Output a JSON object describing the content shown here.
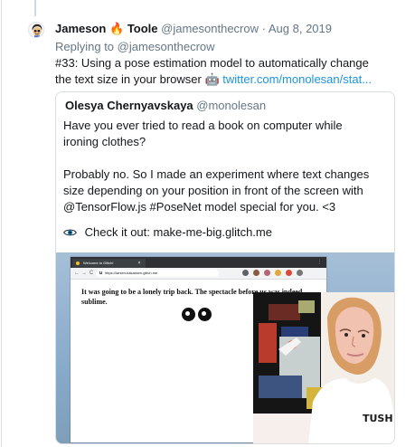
{
  "tweet": {
    "author_name_first": "Jameson",
    "author_emoji": "🔥",
    "author_name_last": "Toole",
    "handle": "@jamesonthecrow",
    "separator": "·",
    "date": "Aug 8, 2019",
    "replying_prefix": "Replying to",
    "replying_to": "@jamesonthecrow",
    "text": "#33: Using a pose estimation model to automatically change the text size in your browser",
    "link_emoji": "🤖",
    "link_text": "twitter.com/monolesan/stat..."
  },
  "quote": {
    "name": "Olesya Chernyavskaya",
    "handle": "@monolesan",
    "paragraphs": [
      "Have you ever tried to read a book on computer while ironing clothes?",
      "Probably no. So I made an experiment where text changes size depending on your position in front of the screen with @TensorFlow.js #PoseNet model special for you. <3"
    ],
    "check_emoji": "👁️",
    "check_text": "Check it out: make-me-big.glitch.me"
  },
  "browser": {
    "tab_title": "Welcome to Glitch!",
    "tab_close": "×",
    "nav_back": "←",
    "nav_forward": "→",
    "nav_reload": "C",
    "address": "https://larsen-kakassen.glitch.me",
    "menu_dots": "⋮",
    "page_text": "It was going to be a lonely trip back. The spectacle before us was indeed sublime."
  },
  "colors": {
    "link_blue": "#1b95e0",
    "text_primary": "#14171a",
    "text_secondary": "#657786",
    "quote_border": "#d8dee3",
    "browser_dark": "#2f3033",
    "sky_blue": "#9fb9d3"
  },
  "icons": {
    "avatar": "jameson-avatar",
    "fire": "fire-emoji",
    "robot": "robot-emoji",
    "eye": "eye-emoji",
    "webcam_person": "webcam-person-image"
  }
}
